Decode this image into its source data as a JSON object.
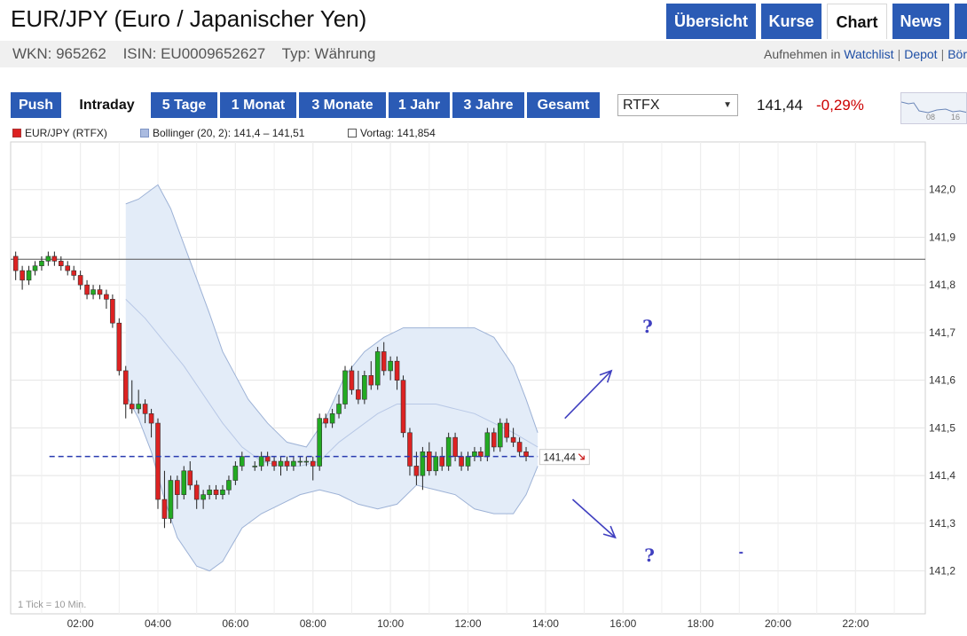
{
  "header": {
    "title": "EUR/JPY (Euro / Japanischer Yen)",
    "wkn": "WKN: 965262",
    "isin": "ISIN: EU0009652627",
    "typ": "Typ: Währung",
    "actions_prefix": "Aufnehmen in",
    "actions": [
      "Watchlist",
      "Depot",
      "Bör"
    ]
  },
  "nav": {
    "tabs": [
      {
        "label": "Übersicht",
        "active": false
      },
      {
        "label": "Kurse",
        "active": false
      },
      {
        "label": "Chart",
        "active": true
      },
      {
        "label": "News",
        "active": false
      },
      {
        "label": "",
        "active": false
      }
    ]
  },
  "toolbar": {
    "ranges": [
      {
        "label": "Push",
        "active": false
      },
      {
        "label": "Intraday",
        "active": true
      },
      {
        "label": "5 Tage",
        "active": false
      },
      {
        "label": "1 Monat",
        "active": false
      },
      {
        "label": "3 Monate",
        "active": false
      },
      {
        "label": "1 Jahr",
        "active": false
      },
      {
        "label": "3 Jahre",
        "active": false
      },
      {
        "label": "Gesamt",
        "active": false
      }
    ],
    "source_select": "RTFX",
    "price": "141,44",
    "change": "-0,29%",
    "thumb_labels": [
      "08",
      "16"
    ]
  },
  "legend": {
    "series": "EUR/JPY (RTFX)",
    "bollinger": "Bollinger (20, 2): 141,4 – 141,51",
    "vortag": "Vortag: 141,854"
  },
  "colors": {
    "up": "#22aa22",
    "down": "#dd2222",
    "band_fill": "#e3ecf8",
    "band_line": "#9db2d6",
    "accent": "#2b5bb5",
    "annotation": "#4040c0"
  },
  "chart_data": {
    "type": "candlestick",
    "x_unit": "hour",
    "xlim": [
      0.2,
      23.8
    ],
    "ylim": [
      141.11,
      142.1
    ],
    "x_ticks": [
      2,
      4,
      6,
      8,
      10,
      12,
      14,
      16,
      18,
      20,
      22
    ],
    "x_tick_labels": [
      "02:00",
      "04:00",
      "06:00",
      "08:00",
      "10:00",
      "12:00",
      "14:00",
      "16:00",
      "18:00",
      "20:00",
      "22:00"
    ],
    "y_ticks": [
      141.2,
      141.3,
      141.4,
      141.5,
      141.6,
      141.7,
      141.8,
      141.9,
      142.0
    ],
    "y_tick_labels": [
      "141,2",
      "141,3",
      "141,4",
      "141,5",
      "141,6",
      "141,7",
      "141,8",
      "141,9",
      "142,0"
    ],
    "previous_close": 141.854,
    "last_price": 141.44,
    "last_price_label": "141,44",
    "tick_note": "1 Tick = 10 Min.",
    "candles": [
      {
        "t": 0.33,
        "o": 141.86,
        "h": 141.87,
        "l": 141.81,
        "c": 141.83
      },
      {
        "t": 0.5,
        "o": 141.83,
        "h": 141.84,
        "l": 141.79,
        "c": 141.81
      },
      {
        "t": 0.67,
        "o": 141.81,
        "h": 141.84,
        "l": 141.8,
        "c": 141.83
      },
      {
        "t": 0.83,
        "o": 141.83,
        "h": 141.85,
        "l": 141.82,
        "c": 141.84
      },
      {
        "t": 1.0,
        "o": 141.84,
        "h": 141.86,
        "l": 141.83,
        "c": 141.85
      },
      {
        "t": 1.17,
        "o": 141.85,
        "h": 141.87,
        "l": 141.84,
        "c": 141.86
      },
      {
        "t": 1.33,
        "o": 141.86,
        "h": 141.87,
        "l": 141.84,
        "c": 141.85
      },
      {
        "t": 1.5,
        "o": 141.85,
        "h": 141.86,
        "l": 141.83,
        "c": 141.84
      },
      {
        "t": 1.67,
        "o": 141.84,
        "h": 141.85,
        "l": 141.82,
        "c": 141.83
      },
      {
        "t": 1.83,
        "o": 141.83,
        "h": 141.84,
        "l": 141.81,
        "c": 141.82
      },
      {
        "t": 2.0,
        "o": 141.82,
        "h": 141.83,
        "l": 141.79,
        "c": 141.8
      },
      {
        "t": 2.17,
        "o": 141.8,
        "h": 141.81,
        "l": 141.77,
        "c": 141.78
      },
      {
        "t": 2.33,
        "o": 141.78,
        "h": 141.8,
        "l": 141.77,
        "c": 141.79
      },
      {
        "t": 2.5,
        "o": 141.79,
        "h": 141.8,
        "l": 141.77,
        "c": 141.78
      },
      {
        "t": 2.67,
        "o": 141.78,
        "h": 141.79,
        "l": 141.75,
        "c": 141.77
      },
      {
        "t": 2.83,
        "o": 141.77,
        "h": 141.78,
        "l": 141.71,
        "c": 141.72
      },
      {
        "t": 3.0,
        "o": 141.72,
        "h": 141.73,
        "l": 141.61,
        "c": 141.62
      },
      {
        "t": 3.17,
        "o": 141.62,
        "h": 141.63,
        "l": 141.52,
        "c": 141.55
      },
      {
        "t": 3.33,
        "o": 141.55,
        "h": 141.6,
        "l": 141.53,
        "c": 141.54
      },
      {
        "t": 3.5,
        "o": 141.54,
        "h": 141.58,
        "l": 141.53,
        "c": 141.55
      },
      {
        "t": 3.67,
        "o": 141.55,
        "h": 141.56,
        "l": 141.51,
        "c": 141.53
      },
      {
        "t": 3.83,
        "o": 141.53,
        "h": 141.54,
        "l": 141.48,
        "c": 141.51
      },
      {
        "t": 4.0,
        "o": 141.51,
        "h": 141.52,
        "l": 141.33,
        "c": 141.35
      },
      {
        "t": 4.17,
        "o": 141.35,
        "h": 141.41,
        "l": 141.29,
        "c": 141.31
      },
      {
        "t": 4.33,
        "o": 141.31,
        "h": 141.4,
        "l": 141.3,
        "c": 141.39
      },
      {
        "t": 4.5,
        "o": 141.39,
        "h": 141.4,
        "l": 141.33,
        "c": 141.36
      },
      {
        "t": 4.67,
        "o": 141.36,
        "h": 141.42,
        "l": 141.35,
        "c": 141.41
      },
      {
        "t": 4.83,
        "o": 141.41,
        "h": 141.43,
        "l": 141.37,
        "c": 141.38
      },
      {
        "t": 5.0,
        "o": 141.38,
        "h": 141.39,
        "l": 141.33,
        "c": 141.35
      },
      {
        "t": 5.17,
        "o": 141.35,
        "h": 141.37,
        "l": 141.33,
        "c": 141.36
      },
      {
        "t": 5.33,
        "o": 141.36,
        "h": 141.38,
        "l": 141.35,
        "c": 141.37
      },
      {
        "t": 5.5,
        "o": 141.37,
        "h": 141.38,
        "l": 141.35,
        "c": 141.36
      },
      {
        "t": 5.67,
        "o": 141.36,
        "h": 141.38,
        "l": 141.35,
        "c": 141.37
      },
      {
        "t": 5.83,
        "o": 141.37,
        "h": 141.4,
        "l": 141.36,
        "c": 141.39
      },
      {
        "t": 6.0,
        "o": 141.39,
        "h": 141.43,
        "l": 141.38,
        "c": 141.42
      },
      {
        "t": 6.17,
        "o": 141.42,
        "h": 141.45,
        "l": 141.41,
        "c": 141.44
      },
      {
        "t": 6.5,
        "o": 141.42,
        "h": 141.43,
        "l": 141.41,
        "c": 141.42
      },
      {
        "t": 6.67,
        "o": 141.42,
        "h": 141.45,
        "l": 141.41,
        "c": 141.44
      },
      {
        "t": 6.83,
        "o": 141.44,
        "h": 141.45,
        "l": 141.42,
        "c": 141.43
      },
      {
        "t": 7.0,
        "o": 141.43,
        "h": 141.44,
        "l": 141.41,
        "c": 141.42
      },
      {
        "t": 7.17,
        "o": 141.42,
        "h": 141.44,
        "l": 141.4,
        "c": 141.43
      },
      {
        "t": 7.33,
        "o": 141.43,
        "h": 141.44,
        "l": 141.41,
        "c": 141.42
      },
      {
        "t": 7.5,
        "o": 141.42,
        "h": 141.44,
        "l": 141.41,
        "c": 141.43
      },
      {
        "t": 7.67,
        "o": 141.43,
        "h": 141.44,
        "l": 141.42,
        "c": 141.43
      },
      {
        "t": 7.83,
        "o": 141.43,
        "h": 141.44,
        "l": 141.42,
        "c": 141.43
      },
      {
        "t": 8.0,
        "o": 141.43,
        "h": 141.44,
        "l": 141.39,
        "c": 141.42
      },
      {
        "t": 8.17,
        "o": 141.42,
        "h": 141.53,
        "l": 141.41,
        "c": 141.52
      },
      {
        "t": 8.33,
        "o": 141.52,
        "h": 141.53,
        "l": 141.5,
        "c": 141.51
      },
      {
        "t": 8.5,
        "o": 141.51,
        "h": 141.54,
        "l": 141.5,
        "c": 141.53
      },
      {
        "t": 8.67,
        "o": 141.53,
        "h": 141.57,
        "l": 141.52,
        "c": 141.55
      },
      {
        "t": 8.83,
        "o": 141.55,
        "h": 141.63,
        "l": 141.54,
        "c": 141.62
      },
      {
        "t": 9.0,
        "o": 141.62,
        "h": 141.63,
        "l": 141.57,
        "c": 141.58
      },
      {
        "t": 9.17,
        "o": 141.58,
        "h": 141.62,
        "l": 141.55,
        "c": 141.56
      },
      {
        "t": 9.33,
        "o": 141.56,
        "h": 141.62,
        "l": 141.55,
        "c": 141.61
      },
      {
        "t": 9.5,
        "o": 141.61,
        "h": 141.64,
        "l": 141.58,
        "c": 141.59
      },
      {
        "t": 9.67,
        "o": 141.59,
        "h": 141.67,
        "l": 141.58,
        "c": 141.66
      },
      {
        "t": 9.83,
        "o": 141.66,
        "h": 141.68,
        "l": 141.61,
        "c": 141.62
      },
      {
        "t": 10.0,
        "o": 141.62,
        "h": 141.65,
        "l": 141.6,
        "c": 141.64
      },
      {
        "t": 10.17,
        "o": 141.64,
        "h": 141.65,
        "l": 141.58,
        "c": 141.6
      },
      {
        "t": 10.33,
        "o": 141.6,
        "h": 141.61,
        "l": 141.48,
        "c": 141.49
      },
      {
        "t": 10.5,
        "o": 141.49,
        "h": 141.5,
        "l": 141.4,
        "c": 141.42
      },
      {
        "t": 10.67,
        "o": 141.42,
        "h": 141.45,
        "l": 141.38,
        "c": 141.4
      },
      {
        "t": 10.83,
        "o": 141.4,
        "h": 141.46,
        "l": 141.37,
        "c": 141.45
      },
      {
        "t": 11.0,
        "o": 141.45,
        "h": 141.47,
        "l": 141.4,
        "c": 141.41
      },
      {
        "t": 11.17,
        "o": 141.41,
        "h": 141.45,
        "l": 141.4,
        "c": 141.44
      },
      {
        "t": 11.33,
        "o": 141.44,
        "h": 141.46,
        "l": 141.41,
        "c": 141.42
      },
      {
        "t": 11.5,
        "o": 141.42,
        "h": 141.49,
        "l": 141.41,
        "c": 141.48
      },
      {
        "t": 11.67,
        "o": 141.48,
        "h": 141.49,
        "l": 141.43,
        "c": 141.44
      },
      {
        "t": 11.83,
        "o": 141.44,
        "h": 141.45,
        "l": 141.41,
        "c": 141.42
      },
      {
        "t": 12.0,
        "o": 141.42,
        "h": 141.45,
        "l": 141.41,
        "c": 141.44
      },
      {
        "t": 12.17,
        "o": 141.44,
        "h": 141.46,
        "l": 141.43,
        "c": 141.45
      },
      {
        "t": 12.33,
        "o": 141.45,
        "h": 141.46,
        "l": 141.43,
        "c": 141.44
      },
      {
        "t": 12.5,
        "o": 141.44,
        "h": 141.5,
        "l": 141.43,
        "c": 141.49
      },
      {
        "t": 12.67,
        "o": 141.49,
        "h": 141.5,
        "l": 141.45,
        "c": 141.46
      },
      {
        "t": 12.83,
        "o": 141.46,
        "h": 141.52,
        "l": 141.45,
        "c": 141.51
      },
      {
        "t": 13.0,
        "o": 141.51,
        "h": 141.52,
        "l": 141.47,
        "c": 141.48
      },
      {
        "t": 13.17,
        "o": 141.48,
        "h": 141.5,
        "l": 141.46,
        "c": 141.47
      },
      {
        "t": 13.33,
        "o": 141.47,
        "h": 141.48,
        "l": 141.44,
        "c": 141.45
      },
      {
        "t": 13.5,
        "o": 141.45,
        "h": 141.46,
        "l": 141.43,
        "c": 141.44
      }
    ],
    "bollinger_upper": [
      [
        3.17,
        141.97
      ],
      [
        3.5,
        141.98
      ],
      [
        3.83,
        142.0
      ],
      [
        4.0,
        142.01
      ],
      [
        4.33,
        141.96
      ],
      [
        4.83,
        141.85
      ],
      [
        5.33,
        141.74
      ],
      [
        5.67,
        141.66
      ],
      [
        6.0,
        141.61
      ],
      [
        6.33,
        141.56
      ],
      [
        6.83,
        141.51
      ],
      [
        7.33,
        141.47
      ],
      [
        7.83,
        141.46
      ],
      [
        8.33,
        141.52
      ],
      [
        8.83,
        141.61
      ],
      [
        9.33,
        141.66
      ],
      [
        9.83,
        141.69
      ],
      [
        10.33,
        141.71
      ],
      [
        10.83,
        141.71
      ],
      [
        11.5,
        141.71
      ],
      [
        12.17,
        141.71
      ],
      [
        12.67,
        141.69
      ],
      [
        13.17,
        141.63
      ],
      [
        13.5,
        141.56
      ],
      [
        13.8,
        141.49
      ]
    ],
    "bollinger_middle": [
      [
        3.17,
        141.77
      ],
      [
        3.67,
        141.73
      ],
      [
        4.17,
        141.68
      ],
      [
        4.67,
        141.63
      ],
      [
        5.17,
        141.57
      ],
      [
        5.67,
        141.51
      ],
      [
        6.17,
        141.46
      ],
      [
        6.67,
        141.43
      ],
      [
        7.17,
        141.42
      ],
      [
        7.67,
        141.42
      ],
      [
        8.17,
        141.43
      ],
      [
        8.67,
        141.47
      ],
      [
        9.17,
        141.5
      ],
      [
        9.67,
        141.53
      ],
      [
        10.17,
        141.55
      ],
      [
        10.67,
        141.55
      ],
      [
        11.17,
        141.55
      ],
      [
        11.67,
        141.54
      ],
      [
        12.17,
        141.53
      ],
      [
        12.67,
        141.51
      ],
      [
        13.17,
        141.49
      ],
      [
        13.8,
        141.46
      ]
    ],
    "bollinger_lower": [
      [
        3.17,
        141.57
      ],
      [
        3.5,
        141.52
      ],
      [
        3.83,
        141.45
      ],
      [
        4.17,
        141.35
      ],
      [
        4.5,
        141.27
      ],
      [
        5.0,
        141.21
      ],
      [
        5.33,
        141.2
      ],
      [
        5.67,
        141.22
      ],
      [
        6.17,
        141.29
      ],
      [
        6.67,
        141.32
      ],
      [
        7.17,
        141.34
      ],
      [
        7.67,
        141.36
      ],
      [
        8.17,
        141.37
      ],
      [
        8.67,
        141.36
      ],
      [
        9.17,
        141.34
      ],
      [
        9.67,
        141.33
      ],
      [
        10.17,
        141.34
      ],
      [
        10.67,
        141.38
      ],
      [
        11.17,
        141.37
      ],
      [
        11.67,
        141.36
      ],
      [
        12.17,
        141.33
      ],
      [
        12.67,
        141.32
      ],
      [
        13.17,
        141.32
      ],
      [
        13.5,
        141.36
      ],
      [
        13.8,
        141.42
      ]
    ],
    "annotations": [
      {
        "type": "arrow",
        "from": [
          14.5,
          141.52
        ],
        "to": [
          15.7,
          141.62
        ]
      },
      {
        "type": "arrow",
        "from": [
          14.7,
          141.35
        ],
        "to": [
          15.8,
          141.27
        ]
      },
      {
        "type": "text",
        "text": "?",
        "at": [
          16.5,
          141.7
        ]
      },
      {
        "type": "text",
        "text": "?",
        "at": [
          16.55,
          141.22
        ]
      },
      {
        "type": "dot",
        "at": [
          19.0,
          141.24
        ]
      }
    ]
  }
}
